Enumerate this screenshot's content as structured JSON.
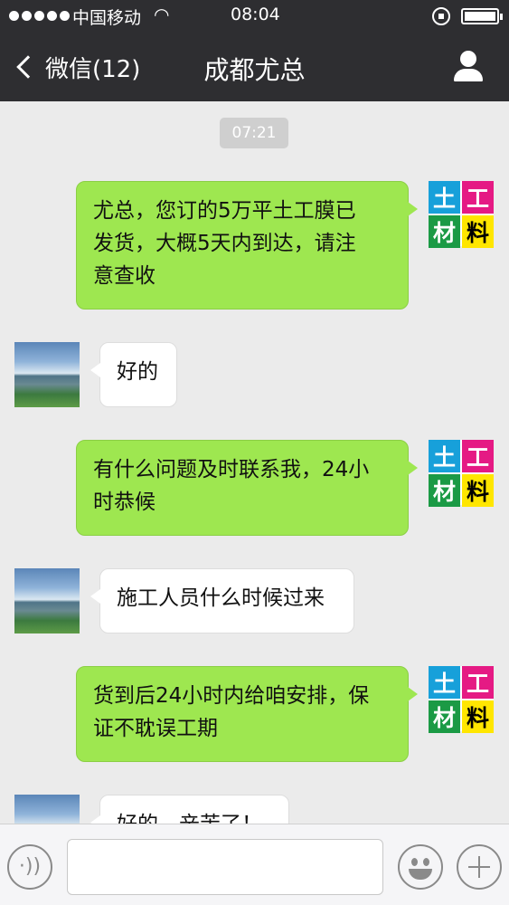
{
  "status_bar": {
    "carrier": "中国移动",
    "time": "08:04"
  },
  "nav": {
    "back_label": "微信(12)",
    "title": "成都尤总"
  },
  "chat": {
    "timestamp": "07:21",
    "brand_logo": [
      "土",
      "工",
      "材",
      "料"
    ],
    "messages": [
      {
        "from": "me",
        "lines": [
          "尤总，您订的5万平土工膜已",
          "发货，大概5天内到达，请注",
          "意查收"
        ]
      },
      {
        "from": "other",
        "lines": [
          "好的"
        ]
      },
      {
        "from": "me",
        "lines": [
          "有什么问题及时联系我，24小",
          "时恭候"
        ]
      },
      {
        "from": "other",
        "lines": [
          "施工人员什么时候过来"
        ]
      },
      {
        "from": "me",
        "lines": [
          "货到后24小时内给咱安排，保",
          "证不耽误工期"
        ]
      },
      {
        "from": "other",
        "lines": [
          "好的，辛苦了！"
        ]
      }
    ]
  },
  "input_bar": {
    "placeholder": ""
  },
  "colors": {
    "nav_bg": "#2e2e31",
    "outgoing_bubble": "#9ee750",
    "incoming_bubble": "#ffffff",
    "chat_bg": "#ebebeb"
  }
}
